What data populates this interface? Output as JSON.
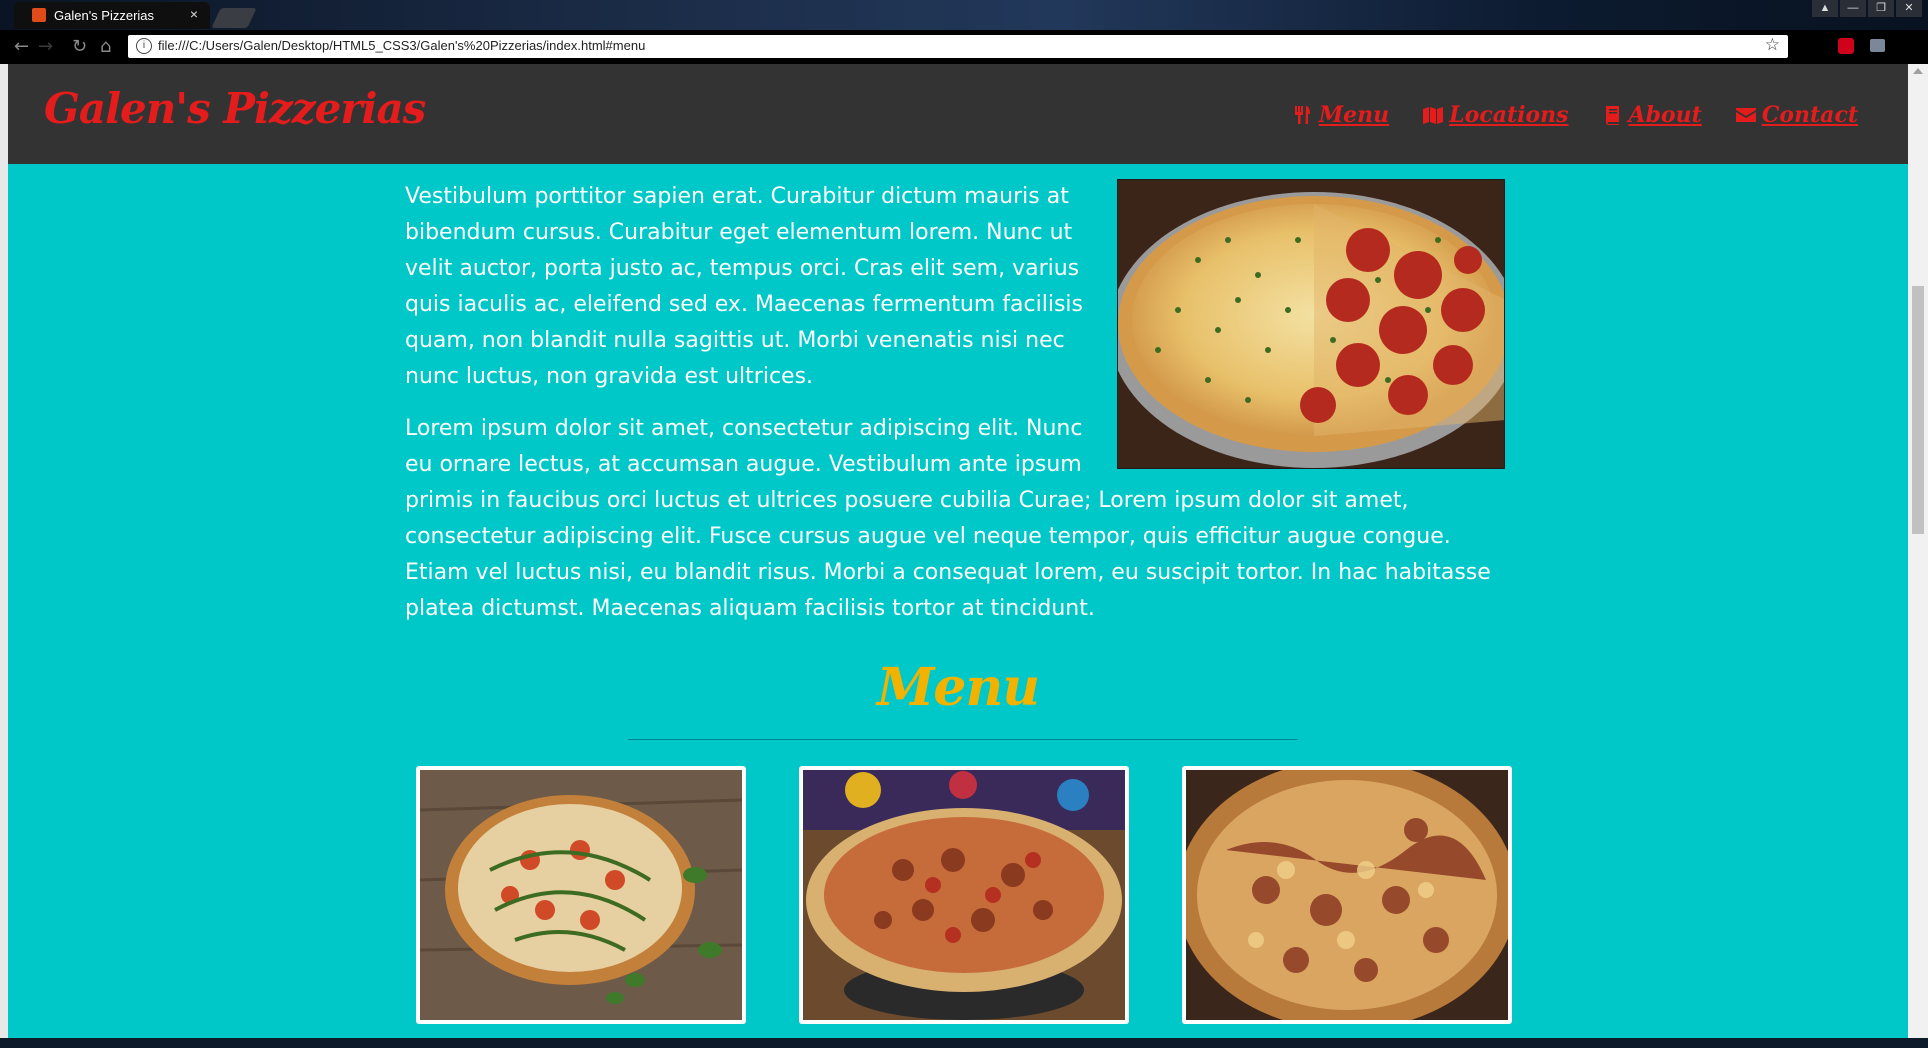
{
  "browser": {
    "tab_title": "Galen's Pizzerias",
    "tab_close": "×",
    "address": "file:///C:/Users/Galen/Desktop/HTML5_CSS3/Galen's%20Pizzerias/index.html#menu",
    "info_glyph": "i",
    "star_glyph": "☆",
    "back_glyph": "←",
    "forward_glyph": "→",
    "reload_glyph": "↻",
    "home_glyph": "⌂"
  },
  "site": {
    "brand": "Galen's Pizzerias",
    "nav": [
      {
        "label": "Menu",
        "icon": "utensils-icon"
      },
      {
        "label": "Locations",
        "icon": "map-icon"
      },
      {
        "label": "About",
        "icon": "book-icon"
      },
      {
        "label": "Contact",
        "icon": "envelope-icon"
      }
    ]
  },
  "about": {
    "paragraph_1": "Vestibulum porttitor sapien erat. Curabitur dictum mauris at bibendum cursus. Curabitur eget elementum lorem. Nunc ut velit auctor, porta justo ac, tempus orci. Cras elit sem, varius quis iaculis ac, eleifend sed ex. Maecenas fermentum facilisis quam, non blandit nulla sagittis ut. Morbi venenatis nisi nec nunc luctus, non gravida est ultrices.",
    "paragraph_2": "Lorem ipsum dolor sit amet, consectetur adipiscing elit. Nunc eu ornare lectus, at accumsan augue. Vestibulum ante ipsum primis in faucibus orci luctus et ultrices posuere cubilia Curae; Lorem ipsum dolor sit amet, consectetur adipiscing elit. Fusce cursus augue vel neque tempor, quis efficitur augue congue. Etiam vel luctus nisi, eu blandit risus. Morbi a consequat lorem, eu suscipit tortor. In hac habitasse platea dictumst. Maecenas aliquam facilisis tortor at tincidunt."
  },
  "menu_section": {
    "heading": "Menu",
    "items": [
      {
        "image": "margherita-pizza"
      },
      {
        "image": "meat-lovers-pizza"
      },
      {
        "image": "bbq-pizza"
      }
    ]
  },
  "colors": {
    "page_bg": "#00c8c8",
    "header_bg": "#333333",
    "brand_red": "#e41c1c",
    "menu_heading": "#f2b300"
  }
}
